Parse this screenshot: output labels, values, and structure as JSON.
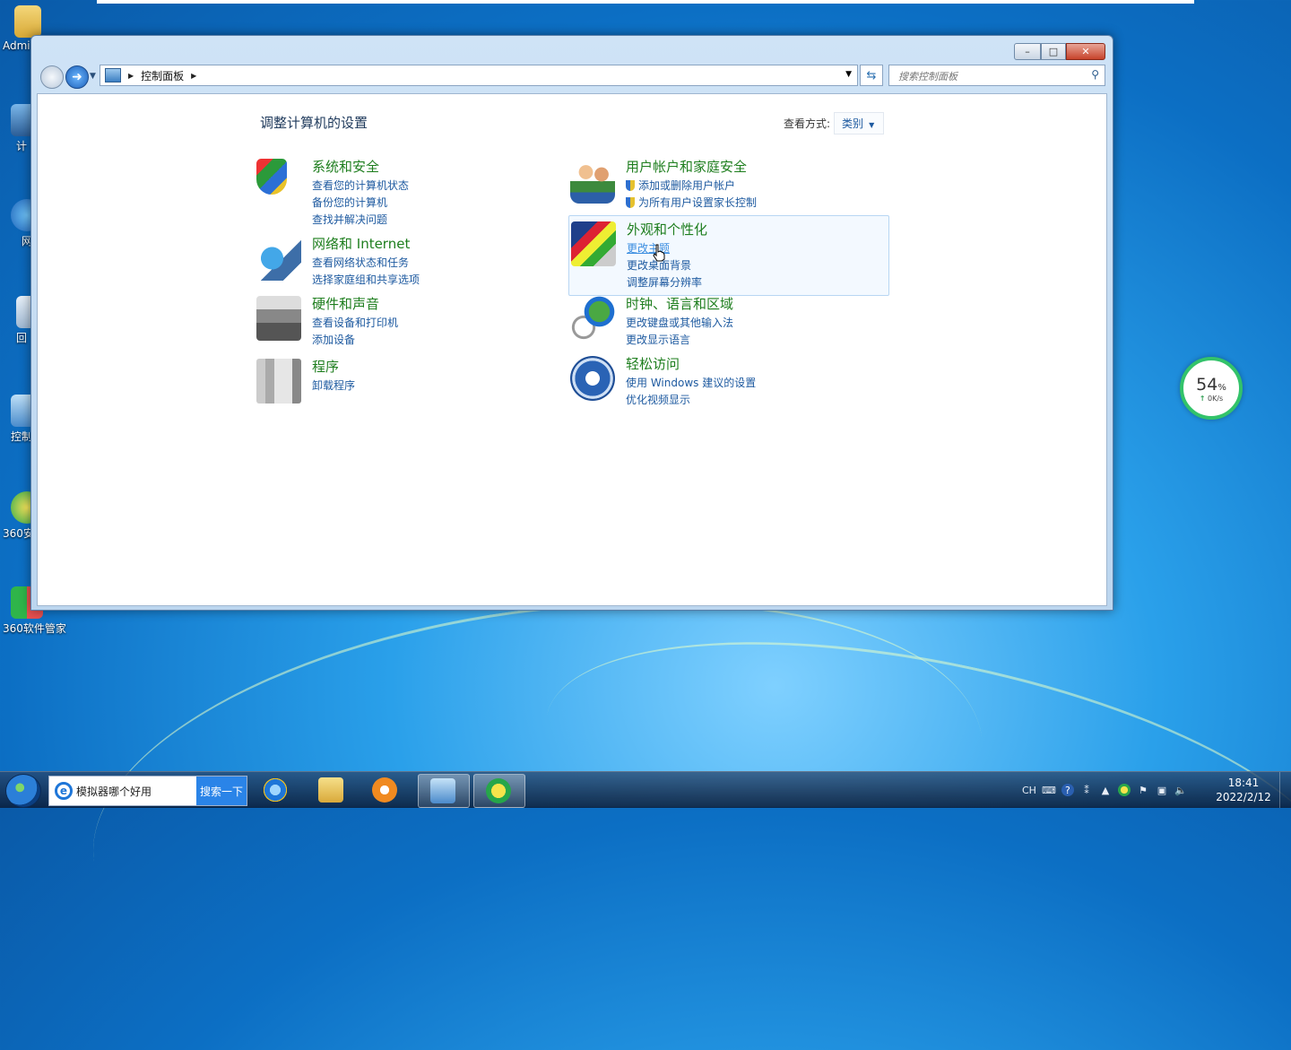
{
  "desktop": {
    "icons": [
      {
        "label": "Admi"
      },
      {
        "label": "计"
      },
      {
        "label": "网"
      },
      {
        "label": "回"
      },
      {
        "label": "控制"
      },
      {
        "label": "360安"
      },
      {
        "label": "360软件管家"
      }
    ]
  },
  "window": {
    "buttons": {
      "minimize": "–",
      "maximize": "□",
      "close": "✕"
    },
    "breadcrumb": [
      "控制面板"
    ],
    "search_placeholder": "搜索控制面板",
    "page_title": "调整计算机的设置",
    "view_by_label": "查看方式:",
    "view_by_value": "类别",
    "categories": [
      {
        "title": "系统和安全",
        "links": [
          "查看您的计算机状态",
          "备份您的计算机",
          "查找并解决问题"
        ],
        "icon": "shield-icon"
      },
      {
        "title": "网络和 Internet",
        "links": [
          "查看网络状态和任务",
          "选择家庭组和共享选项"
        ],
        "icon": "network-icon"
      },
      {
        "title": "硬件和声音",
        "links": [
          "查看设备和打印机",
          "添加设备"
        ],
        "icon": "printer-icon"
      },
      {
        "title": "程序",
        "links": [
          "卸载程序"
        ],
        "icon": "programs-icon"
      },
      {
        "title": "用户帐户和家庭安全",
        "links": [
          "添加或删除用户帐户",
          "为所有用户设置家长控制"
        ],
        "icon": "users-icon"
      },
      {
        "title": "外观和个性化",
        "links": [
          "更改主题",
          "更改桌面背景",
          "调整屏幕分辨率"
        ],
        "icon": "personalization-icon"
      },
      {
        "title": "时钟、语言和区域",
        "links": [
          "更改键盘或其他输入法",
          "更改显示语言"
        ],
        "icon": "clock-globe-icon"
      },
      {
        "title": "轻松访问",
        "links": [
          "使用 Windows 建议的设置",
          "优化视频显示"
        ],
        "icon": "ease-of-access-icon"
      }
    ]
  },
  "speed_widget": {
    "percent": "54",
    "percent_unit": "%",
    "rate": "0K/s"
  },
  "taskbar": {
    "search_text": "模拟器哪个好用",
    "search_button": "搜索一下",
    "tray_lang": "CH",
    "time": "18:41",
    "date": "2022/2/12"
  },
  "colors": {
    "category_title": "#1e7e1e",
    "link": "#1e5aa0",
    "accent_green": "#33c36a"
  }
}
